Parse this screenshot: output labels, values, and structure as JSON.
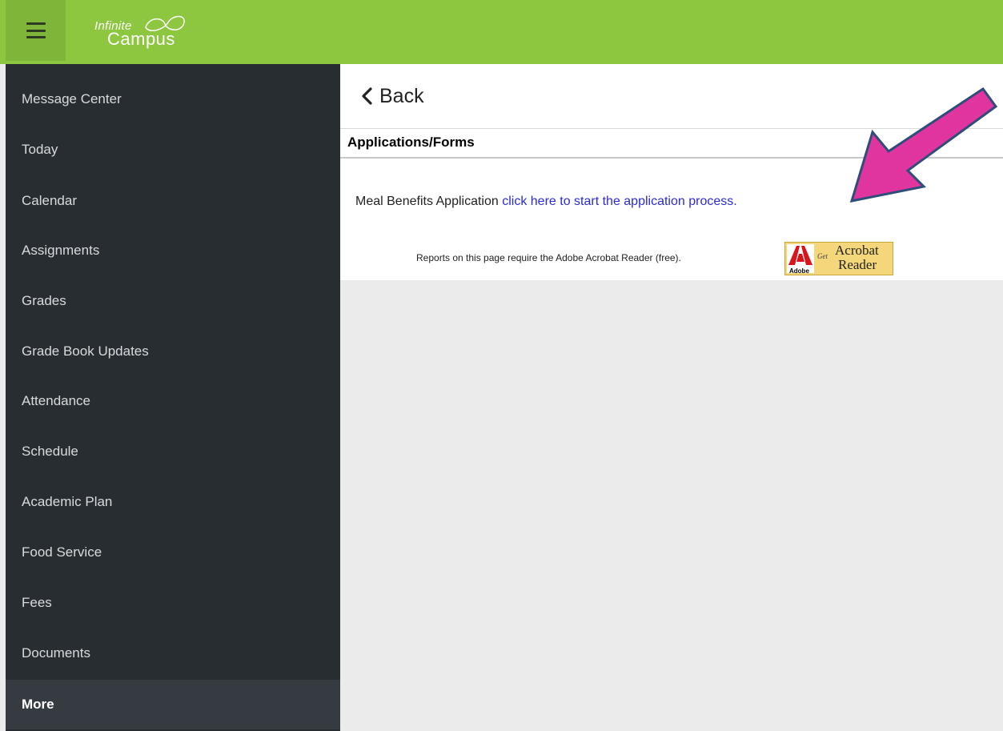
{
  "app": {
    "logo_line1": "Infinite",
    "logo_line2": "Campus",
    "brand_color": "#8dc63f"
  },
  "sidebar": {
    "items": [
      {
        "label": "Message Center"
      },
      {
        "label": "Today"
      },
      {
        "label": "Calendar"
      },
      {
        "label": "Assignments"
      },
      {
        "label": "Grades"
      },
      {
        "label": "Grade Book Updates"
      },
      {
        "label": "Attendance"
      },
      {
        "label": "Schedule"
      },
      {
        "label": "Academic Plan"
      },
      {
        "label": "Food Service"
      },
      {
        "label": "Fees"
      },
      {
        "label": "Documents"
      },
      {
        "label": "More",
        "active": true
      }
    ]
  },
  "main": {
    "back_label": "Back",
    "section_title": "Applications/Forms",
    "meal_prefix": "Meal Benefits Application ",
    "meal_link": "click here to start the application process.",
    "reports_text": "Reports on this page require the Adobe Acrobat Reader (free).",
    "acrobat_badge": {
      "adobe": "Adobe",
      "get": "Get",
      "acrobat": "Acrobat",
      "reader": "Reader"
    }
  },
  "annotation": {
    "arrow_color": "#e0349f",
    "icon": "arrow-pointer-icon"
  }
}
